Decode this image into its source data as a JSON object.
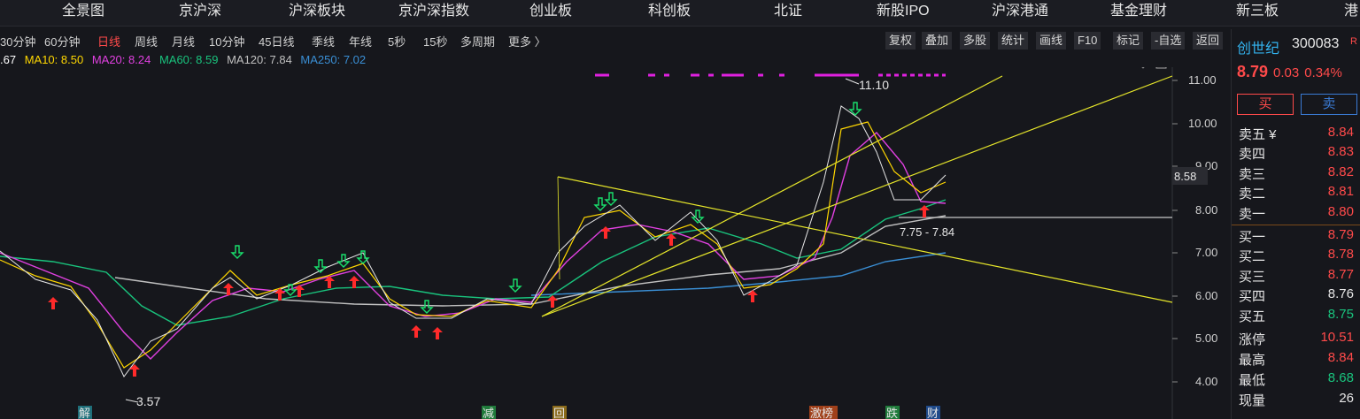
{
  "nav": [
    "全景图",
    "京沪深",
    "沪深板块",
    "京沪深指数",
    "创业板",
    "科创板",
    "北证",
    "新股IPO",
    "沪深港通",
    "基金理财",
    "新三板",
    "港"
  ],
  "periods": [
    "30分钟",
    "60分钟",
    "日线",
    "周线",
    "月线",
    "10分钟",
    "45日线",
    "季线",
    "年线",
    "5秒",
    "15秒",
    "多周期",
    "更多 〉"
  ],
  "active_period": "日线",
  "tools": [
    "复权",
    "叠加",
    "多股",
    "统计",
    "画线",
    "F10",
    "标记",
    "-自选",
    "返回"
  ],
  "ma": {
    "ma5": ".67",
    "ma10": "MA10: 8.50",
    "ma20": "MA20: 8.24",
    "ma60": "MA60: 8.59",
    "ma120": "MA120: 7.84",
    "ma250": "MA250: 7.02"
  },
  "colors": {
    "ma5": "#ffffff",
    "ma10": "#ffd700",
    "ma20": "#e040e0",
    "ma60": "#19c37d",
    "ma120": "#c0c0c0",
    "ma250": "#3a8fd5",
    "trend": "#e6e62a"
  },
  "chart_data": {
    "type": "line",
    "yticks": [
      "11.00",
      "10.00",
      "9.00",
      "8.00",
      "7.00",
      "6.00",
      "5.00",
      "4.00"
    ],
    "current_price_label": "8.58",
    "high_label": "11.10",
    "low_label": "3.57",
    "range_label": "7.75 - 7.84",
    "bottom_markers": [
      "解",
      "减",
      "回",
      "激榜",
      "跌",
      "财"
    ]
  },
  "stock": {
    "name": "创世纪",
    "code": "300083",
    "suffix": "R",
    "price": "8.79",
    "change": "0.03",
    "pct": "0.34%",
    "buy": "买",
    "sell": "卖"
  },
  "orderbook_sell": [
    {
      "label": "卖五 ¥",
      "price": "8.84"
    },
    {
      "label": "卖四",
      "price": "8.83"
    },
    {
      "label": "卖三",
      "price": "8.82"
    },
    {
      "label": "卖二",
      "price": "8.81"
    },
    {
      "label": "卖一",
      "price": "8.80"
    }
  ],
  "orderbook_buy": [
    {
      "label": "买一",
      "price": "8.79",
      "cls": "red"
    },
    {
      "label": "买二",
      "price": "8.78",
      "cls": "red"
    },
    {
      "label": "买三",
      "price": "8.77",
      "cls": "red"
    },
    {
      "label": "买四",
      "price": "8.76",
      "cls": "white"
    },
    {
      "label": "买五",
      "price": "8.75",
      "cls": "green"
    }
  ],
  "stats": [
    {
      "label": "涨停",
      "value": "10.51",
      "cls": "red"
    },
    {
      "label": "最高",
      "value": "8.84",
      "cls": "red"
    },
    {
      "label": "最低",
      "value": "8.68",
      "cls": "green"
    },
    {
      "label": "现量",
      "value": "26",
      "cls": "white"
    }
  ]
}
